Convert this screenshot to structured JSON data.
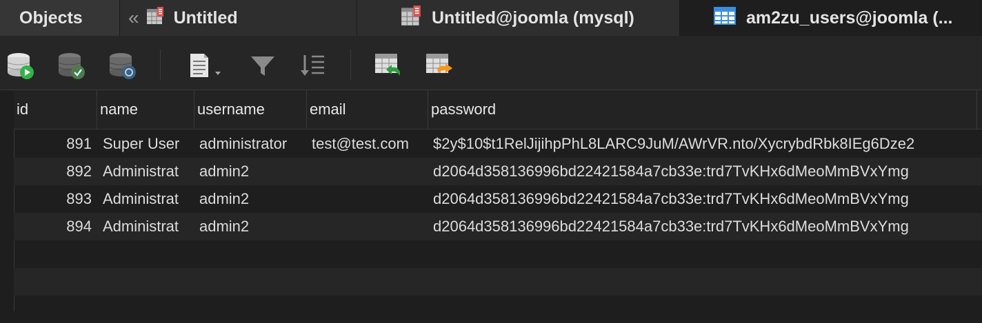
{
  "tabs": [
    {
      "label": "Objects"
    },
    {
      "label": "Untitled"
    },
    {
      "label": "Untitled@joomla (mysql)"
    },
    {
      "label": "am2zu_users@joomla (..."
    }
  ],
  "toolbar": {
    "buttons": [
      {
        "icon": "db-run-icon"
      },
      {
        "icon": "db-check-icon"
      },
      {
        "icon": "db-history-icon"
      },
      {
        "icon": "document-menu-icon"
      },
      {
        "icon": "filter-icon"
      },
      {
        "icon": "sort-icon"
      },
      {
        "icon": "table-import-icon"
      },
      {
        "icon": "table-export-icon"
      }
    ]
  },
  "table": {
    "columns": [
      "id",
      "name",
      "username",
      "email",
      "password"
    ],
    "rows": [
      {
        "id": "891",
        "name": "Super User",
        "username": "administrator",
        "email": "test@test.com",
        "password": "$2y$10$t1RelJijihpPhL8LARC9JuM/AWrVR.nto/XycrybdRbk8IEg6Dze2"
      },
      {
        "id": "892",
        "name": "Administrat",
        "username": "admin2",
        "email": "",
        "password": "d2064d358136996bd22421584a7cb33e:trd7TvKHx6dMeoMmBVxYmg"
      },
      {
        "id": "893",
        "name": "Administrat",
        "username": "admin2",
        "email": "",
        "password": "d2064d358136996bd22421584a7cb33e:trd7TvKHx6dMeoMmBVxYmg"
      },
      {
        "id": "894",
        "name": "Administrat",
        "username": "admin2",
        "email": "",
        "password": "d2064d358136996bd22421584a7cb33e:trd7TvKHx6dMeoMmBVxYmg"
      }
    ]
  }
}
